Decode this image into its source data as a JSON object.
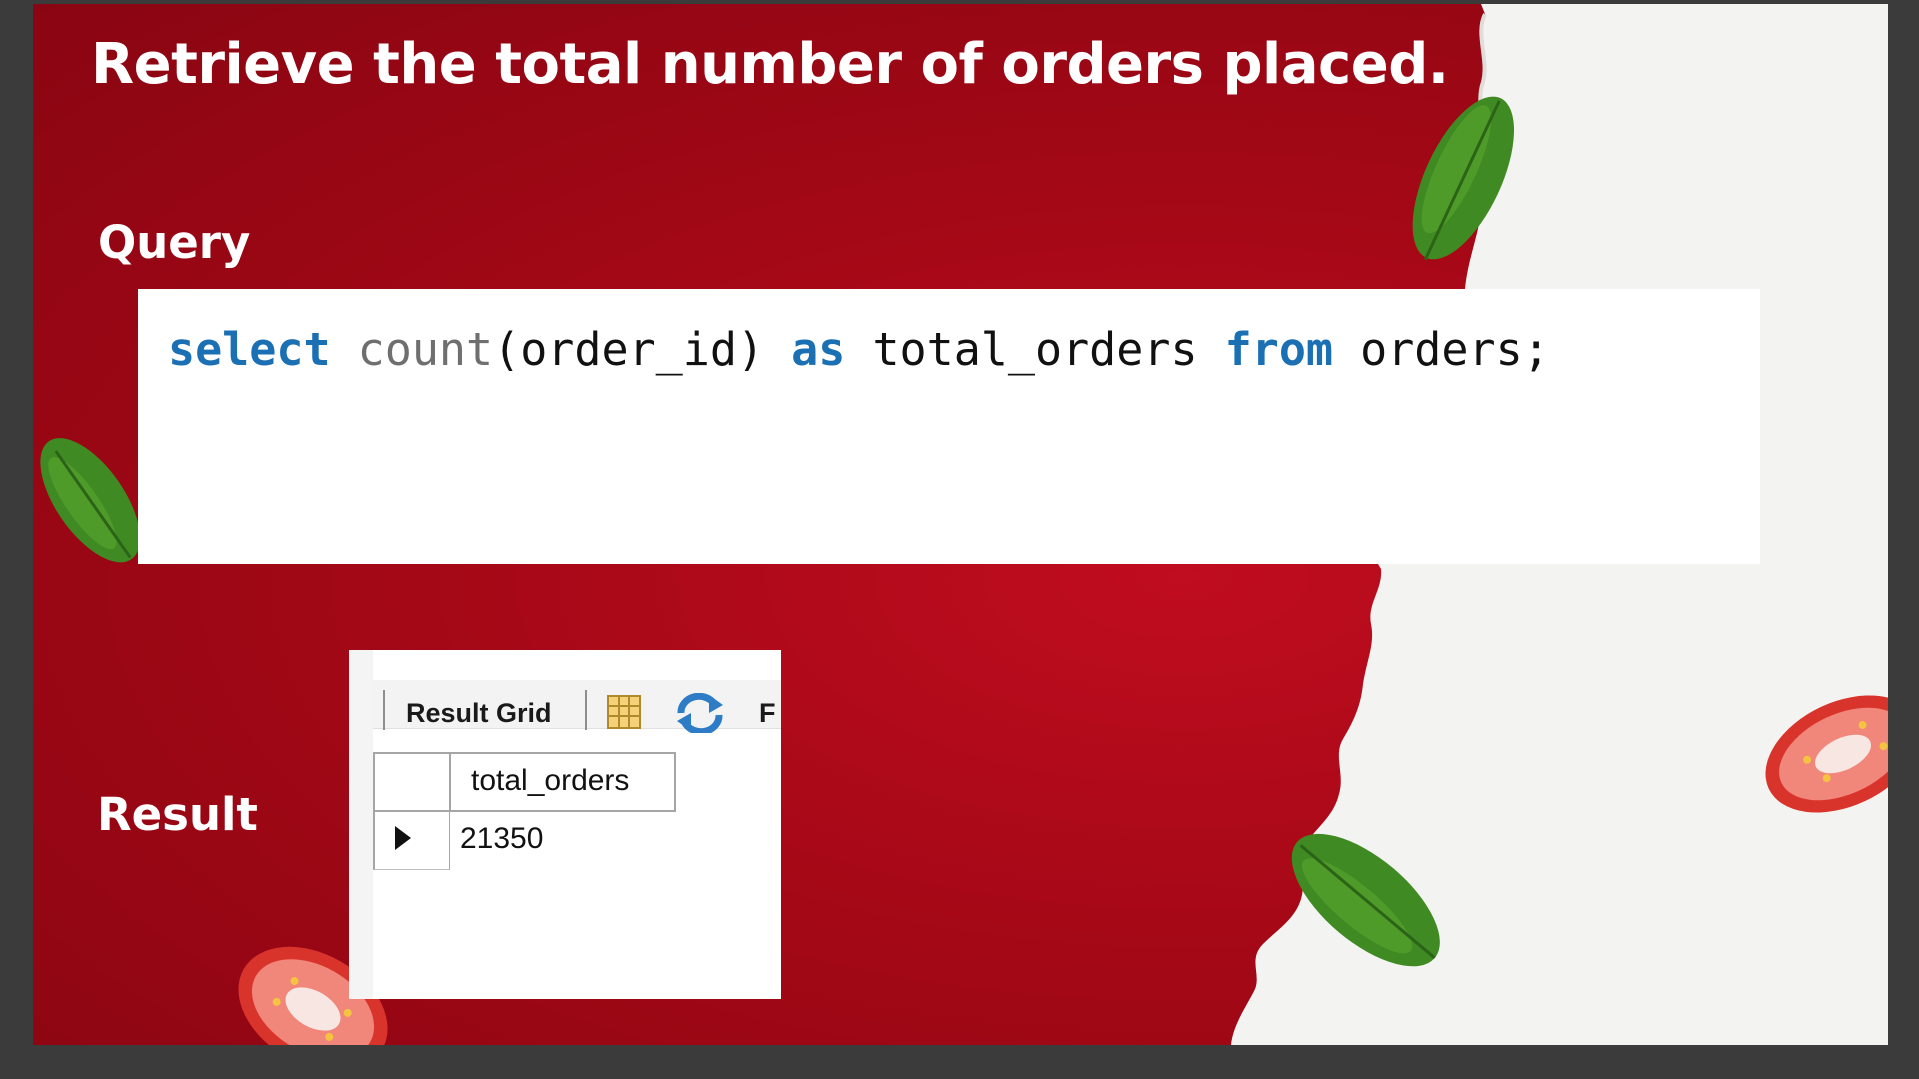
{
  "slide": {
    "title": "Retrieve the total number of orders placed.",
    "query_label": "Query",
    "result_label": "Result"
  },
  "query": {
    "tokens": {
      "select": "select",
      "count": "count",
      "arg": "(order_id)",
      "as": "as",
      "alias": "total_orders",
      "from": "from",
      "table": "orders;"
    }
  },
  "result_panel": {
    "toolbar_label": "Result Grid",
    "truncated_text": "F",
    "icons": [
      "grid-view-icon",
      "refresh-icon"
    ],
    "columns": [
      "total_orders"
    ],
    "rows": [
      [
        "21350"
      ]
    ]
  },
  "colors": {
    "background_red": "#a50816",
    "keyword_blue": "#1b6fb3",
    "function_gray": "#6f6f6f",
    "leaf_green": "#3f8a22",
    "tomato_red": "#d9342b"
  }
}
